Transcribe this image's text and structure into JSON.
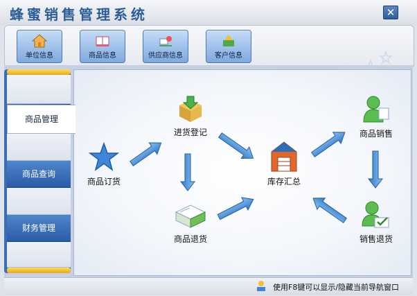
{
  "app": {
    "title": "蜂蜜销售管理系统"
  },
  "toolbar": {
    "buttons": [
      {
        "label": "单位信息",
        "icon": "house-icon"
      },
      {
        "label": "商品信息",
        "icon": "book-icon"
      },
      {
        "label": "供应商信息",
        "icon": "supplier-icon"
      },
      {
        "label": "客户信息",
        "icon": "customer-icon"
      }
    ]
  },
  "sidebar": {
    "items": [
      {
        "label": ""
      },
      {
        "label": "商品管理"
      },
      {
        "label": ""
      },
      {
        "label": "商品查询"
      },
      {
        "label": ""
      },
      {
        "label": "财务管理"
      },
      {
        "label": ""
      }
    ],
    "active": "商品管理"
  },
  "flow": {
    "nodes": {
      "order": "商品订货",
      "purchase": "进货登记",
      "return_goods": "商品退货",
      "inventory": "库存汇总",
      "sales": "商品销售",
      "sales_return": "销售退货"
    }
  },
  "status": {
    "text": "使用F8键可以显示/隐藏当前导航窗口"
  },
  "colors": {
    "accent": "#2d5d97",
    "arrow": "#4b8fd6",
    "sidebar_gold": "#f0c030"
  }
}
